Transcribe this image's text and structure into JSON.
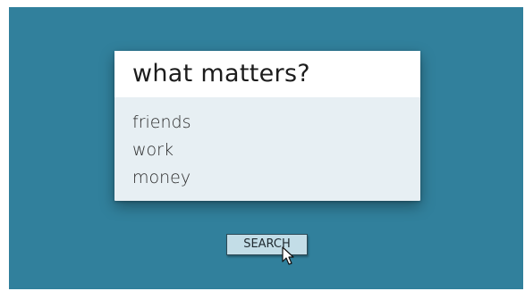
{
  "search_box": {
    "value": "what matters?"
  },
  "suggestions": [
    {
      "label": "friends"
    },
    {
      "label": "work"
    },
    {
      "label": "money"
    }
  ],
  "search_button": {
    "label": "SEARCH"
  },
  "cursor": {
    "icon": "mouse-pointer-icon"
  },
  "colors": {
    "background": "#31809c",
    "dropdown": "#e7eff3",
    "input": "#ffffff",
    "button": "#c3dde7"
  }
}
